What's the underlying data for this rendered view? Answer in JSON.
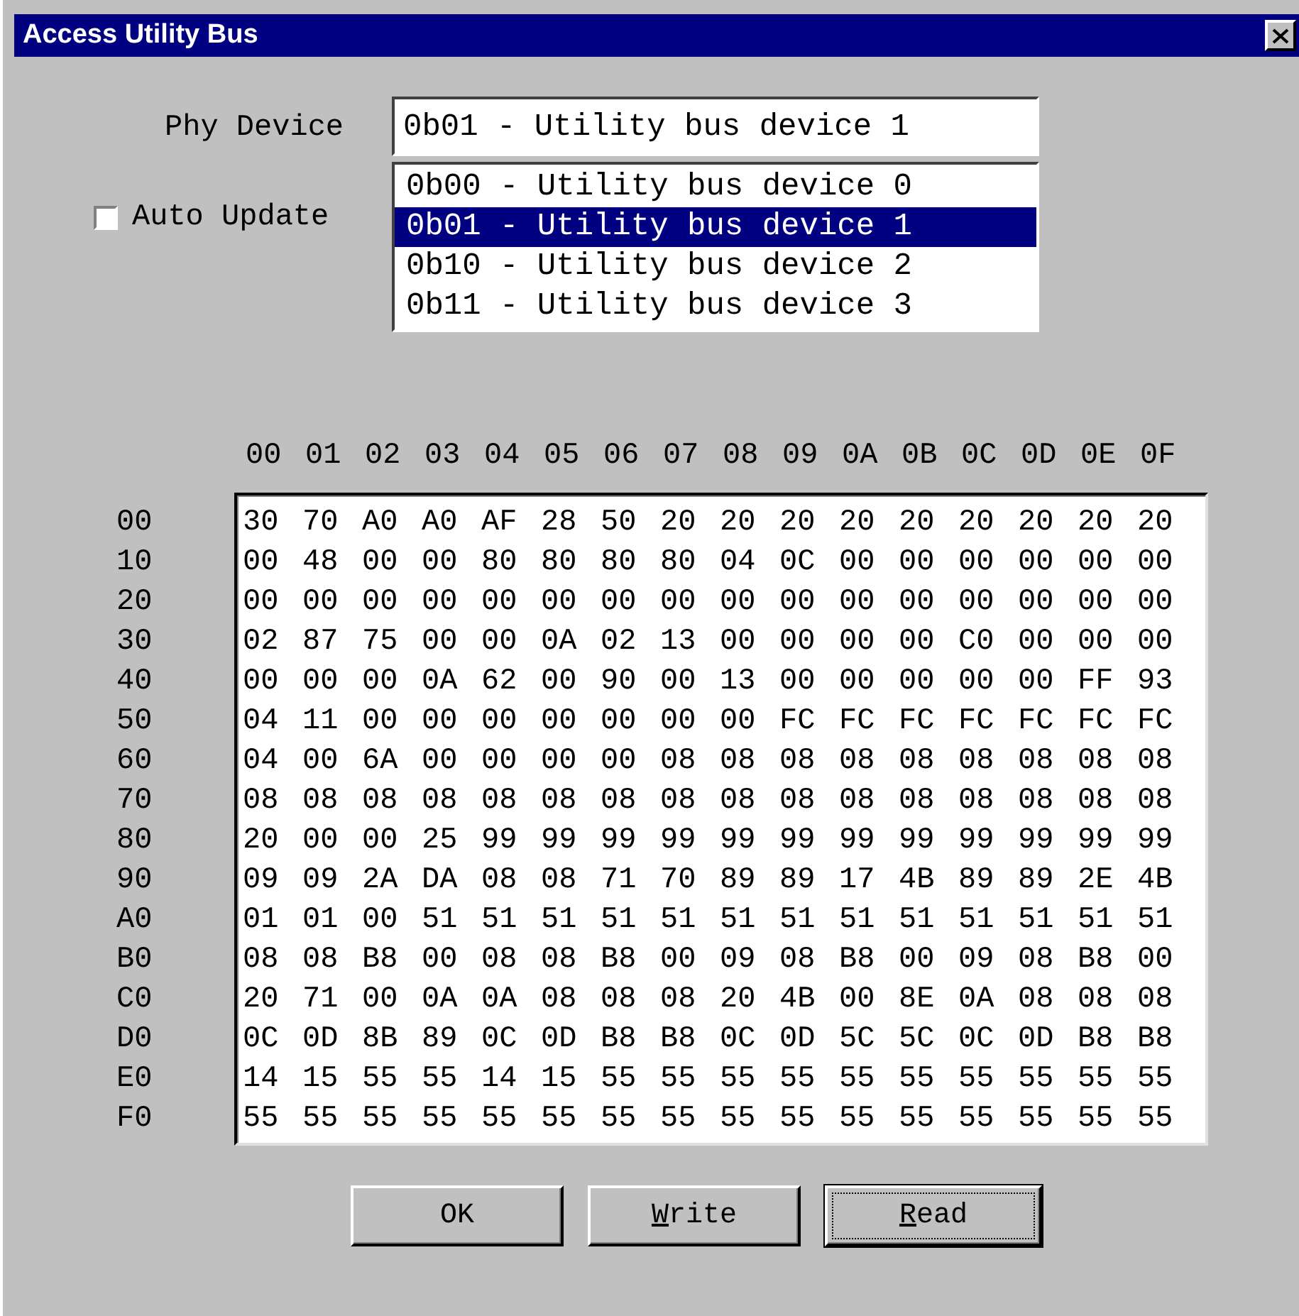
{
  "window": {
    "title": "Access Utility Bus"
  },
  "phy_device": {
    "label": "Phy Device",
    "value": "0b01 - Utility bus device 1",
    "options": [
      {
        "text": "0b00 - Utility bus device 0",
        "selected": false
      },
      {
        "text": "0b01 - Utility bus device 1",
        "selected": true
      },
      {
        "text": "0b10 - Utility bus device 2",
        "selected": false
      },
      {
        "text": "0b11 - Utility bus device 3",
        "selected": false
      }
    ]
  },
  "auto_update": {
    "label": "Auto Update",
    "checked": false
  },
  "hex_view": {
    "column_headers": [
      "00",
      "01",
      "02",
      "03",
      "04",
      "05",
      "06",
      "07",
      "08",
      "09",
      "0A",
      "0B",
      "0C",
      "0D",
      "0E",
      "0F"
    ],
    "rows": [
      {
        "label": "00",
        "cells": [
          "30",
          "70",
          "A0",
          "A0",
          "AF",
          "28",
          "50",
          "20",
          "20",
          "20",
          "20",
          "20",
          "20",
          "20",
          "20",
          "20"
        ]
      },
      {
        "label": "10",
        "cells": [
          "00",
          "48",
          "00",
          "00",
          "80",
          "80",
          "80",
          "80",
          "04",
          "0C",
          "00",
          "00",
          "00",
          "00",
          "00",
          "00"
        ]
      },
      {
        "label": "20",
        "cells": [
          "00",
          "00",
          "00",
          "00",
          "00",
          "00",
          "00",
          "00",
          "00",
          "00",
          "00",
          "00",
          "00",
          "00",
          "00",
          "00"
        ]
      },
      {
        "label": "30",
        "cells": [
          "02",
          "87",
          "75",
          "00",
          "00",
          "0A",
          "02",
          "13",
          "00",
          "00",
          "00",
          "00",
          "C0",
          "00",
          "00",
          "00"
        ]
      },
      {
        "label": "40",
        "cells": [
          "00",
          "00",
          "00",
          "0A",
          "62",
          "00",
          "90",
          "00",
          "13",
          "00",
          "00",
          "00",
          "00",
          "00",
          "FF",
          "93"
        ]
      },
      {
        "label": "50",
        "cells": [
          "04",
          "11",
          "00",
          "00",
          "00",
          "00",
          "00",
          "00",
          "00",
          "FC",
          "FC",
          "FC",
          "FC",
          "FC",
          "FC",
          "FC"
        ]
      },
      {
        "label": "60",
        "cells": [
          "04",
          "00",
          "6A",
          "00",
          "00",
          "00",
          "00",
          "08",
          "08",
          "08",
          "08",
          "08",
          "08",
          "08",
          "08",
          "08"
        ]
      },
      {
        "label": "70",
        "cells": [
          "08",
          "08",
          "08",
          "08",
          "08",
          "08",
          "08",
          "08",
          "08",
          "08",
          "08",
          "08",
          "08",
          "08",
          "08",
          "08"
        ]
      },
      {
        "label": "80",
        "cells": [
          "20",
          "00",
          "00",
          "25",
          "99",
          "99",
          "99",
          "99",
          "99",
          "99",
          "99",
          "99",
          "99",
          "99",
          "99",
          "99"
        ]
      },
      {
        "label": "90",
        "cells": [
          "09",
          "09",
          "2A",
          "DA",
          "08",
          "08",
          "71",
          "70",
          "89",
          "89",
          "17",
          "4B",
          "89",
          "89",
          "2E",
          "4B"
        ]
      },
      {
        "label": "A0",
        "cells": [
          "01",
          "01",
          "00",
          "51",
          "51",
          "51",
          "51",
          "51",
          "51",
          "51",
          "51",
          "51",
          "51",
          "51",
          "51",
          "51"
        ]
      },
      {
        "label": "B0",
        "cells": [
          "08",
          "08",
          "B8",
          "00",
          "08",
          "08",
          "B8",
          "00",
          "09",
          "08",
          "B8",
          "00",
          "09",
          "08",
          "B8",
          "00"
        ]
      },
      {
        "label": "C0",
        "cells": [
          "20",
          "71",
          "00",
          "0A",
          "0A",
          "08",
          "08",
          "08",
          "20",
          "4B",
          "00",
          "8E",
          "0A",
          "08",
          "08",
          "08"
        ]
      },
      {
        "label": "D0",
        "cells": [
          "0C",
          "0D",
          "8B",
          "89",
          "0C",
          "0D",
          "B8",
          "B8",
          "0C",
          "0D",
          "5C",
          "5C",
          "0C",
          "0D",
          "B8",
          "B8"
        ]
      },
      {
        "label": "E0",
        "cells": [
          "14",
          "15",
          "55",
          "55",
          "14",
          "15",
          "55",
          "55",
          "55",
          "55",
          "55",
          "55",
          "55",
          "55",
          "55",
          "55"
        ]
      },
      {
        "label": "F0",
        "cells": [
          "55",
          "55",
          "55",
          "55",
          "55",
          "55",
          "55",
          "55",
          "55",
          "55",
          "55",
          "55",
          "55",
          "55",
          "55",
          "55"
        ]
      }
    ]
  },
  "buttons": [
    {
      "label": "OK",
      "default": false
    },
    {
      "access_key": "W",
      "label": "rite",
      "default": false
    },
    {
      "access_key": "R",
      "label": "ead",
      "default": true
    }
  ]
}
